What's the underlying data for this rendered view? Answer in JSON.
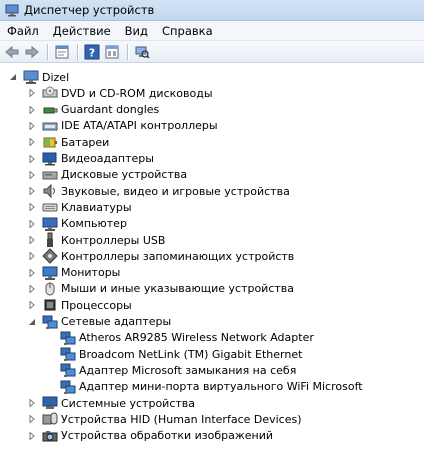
{
  "window": {
    "title": "Диспетчер устройств"
  },
  "menu": [
    "Файл",
    "Действие",
    "Вид",
    "Справка"
  ],
  "toolbar": {
    "icons": [
      "back-arrow-icon",
      "forward-arrow-icon",
      "properties-icon",
      "help-icon",
      "view-icon",
      "scan-hardware-icon"
    ]
  },
  "tree": {
    "root": "Dizel",
    "categories": [
      {
        "label": "DVD и CD-ROM дисководы",
        "icon": "dvd-drive-icon"
      },
      {
        "label": "Guardant dongles",
        "icon": "dongle-icon"
      },
      {
        "label": "IDE ATA/ATAPI контроллеры",
        "icon": "ide-controller-icon"
      },
      {
        "label": "Батареи",
        "icon": "battery-icon"
      },
      {
        "label": "Видеоадаптеры",
        "icon": "display-adapter-icon"
      },
      {
        "label": "Дисковые устройства",
        "icon": "disk-drive-icon"
      },
      {
        "label": "Звуковые, видео и игровые устройства",
        "icon": "sound-icon"
      },
      {
        "label": "Клавиатуры",
        "icon": "keyboard-icon"
      },
      {
        "label": "Компьютер",
        "icon": "computer-icon"
      },
      {
        "label": "Контроллеры USB",
        "icon": "usb-icon"
      },
      {
        "label": "Контроллеры запоминающих устройств",
        "icon": "storage-controller-icon"
      },
      {
        "label": "Мониторы",
        "icon": "monitor-icon"
      },
      {
        "label": "Мыши и иные указывающие устройства",
        "icon": "mouse-icon"
      },
      {
        "label": "Процессоры",
        "icon": "processor-icon"
      },
      {
        "label": "Сетевые адаптеры",
        "icon": "network-adapter-icon",
        "expanded": true,
        "children": [
          "Atheros AR9285 Wireless Network Adapter",
          "Broadcom NetLink (TM) Gigabit Ethernet",
          "Адаптер Microsoft замыкания на себя",
          "Адаптер мини-порта виртуального WiFi Microsoft"
        ]
      },
      {
        "label": "Системные устройства",
        "icon": "system-device-icon"
      },
      {
        "label": "Устройства HID (Human Interface Devices)",
        "icon": "hid-icon"
      },
      {
        "label": "Устройства обработки изображений",
        "icon": "imaging-device-icon"
      }
    ]
  },
  "colors": {
    "titlebar": "#c8dbf1",
    "expander": "#6b6b6b",
    "network_icon": "#3a6fb5"
  }
}
